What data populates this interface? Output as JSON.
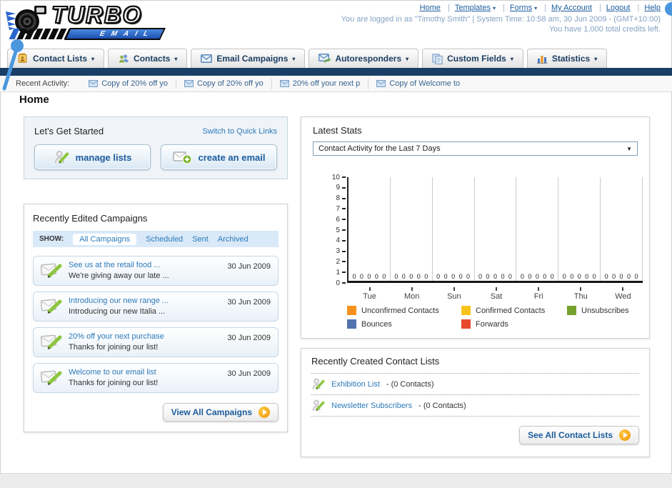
{
  "icons": {
    "chevron_down": "▾",
    "dropdown_caret": "▼"
  },
  "header": {
    "logo": {
      "title": "TURBO",
      "subtitle": "EMAIL"
    },
    "nav": [
      {
        "label": "Home",
        "dropdown": false
      },
      {
        "label": "Templates",
        "dropdown": true
      },
      {
        "label": "Forms",
        "dropdown": true
      },
      {
        "label": "My Account",
        "dropdown": false
      },
      {
        "label": "Logout",
        "dropdown": false
      },
      {
        "label": "Help",
        "dropdown": false
      }
    ],
    "login_line": "You are logged in as \"Timothy Smith\" | System Time: 10:58 am, 30 Jun 2009 - (GMT+10:00)",
    "credits_line": "You have 1,000 total credits left."
  },
  "tabs": [
    {
      "label": "Contact Lists"
    },
    {
      "label": "Contacts"
    },
    {
      "label": "Email Campaigns"
    },
    {
      "label": "Autoresponders"
    },
    {
      "label": "Custom Fields"
    },
    {
      "label": "Statistics"
    }
  ],
  "recent_activity": {
    "label": "Recent Activity:",
    "items": [
      "Copy of 20% off yo",
      "Copy of 20% off yo",
      "20% off your next p",
      "Copy of Welcome to"
    ]
  },
  "page_title": "Home",
  "get_started": {
    "title": "Let's Get Started",
    "switch_link": "Switch to Quick Links",
    "buttons": [
      {
        "label": "manage lists"
      },
      {
        "label": "create an email"
      }
    ]
  },
  "campaigns_panel": {
    "title": "Recently Edited Campaigns",
    "show_label": "SHOW:",
    "filters": [
      "All Campaigns",
      "Scheduled",
      "Sent",
      "Archived"
    ],
    "active_filter": "All Campaigns",
    "items": [
      {
        "title": "See us at the retail food ...",
        "subtitle": "We're giving away our late ...",
        "date": "30 Jun 2009"
      },
      {
        "title": "Introducing our new range ...",
        "subtitle": "Introducing our new Italia ...",
        "date": "30 Jun 2009"
      },
      {
        "title": "20% off your next purchase",
        "subtitle": "Thanks for joining our list!",
        "date": "30 Jun 2009"
      },
      {
        "title": "Welcome to our email list",
        "subtitle": "Thanks for joining our list!",
        "date": "30 Jun 2009"
      }
    ],
    "view_all_label": "View All Campaigns"
  },
  "stats_panel": {
    "title": "Latest Stats",
    "dropdown_value": "Contact Activity for the Last 7 Days"
  },
  "chart_data": {
    "type": "bar",
    "title": "Contact Activity for the Last 7 Days",
    "categories": [
      "Tue",
      "Mon",
      "Sun",
      "Sat",
      "Fri",
      "Thu",
      "Wed"
    ],
    "series": [
      {
        "name": "Unconfirmed Contacts",
        "color": "#f5911e",
        "values": [
          0,
          0,
          0,
          0,
          0,
          0,
          0
        ]
      },
      {
        "name": "Confirmed Contacts",
        "color": "#f8c31c",
        "values": [
          0,
          0,
          0,
          0,
          0,
          0,
          0
        ]
      },
      {
        "name": "Unsubscribes",
        "color": "#76a22d",
        "values": [
          0,
          0,
          0,
          0,
          0,
          0,
          0
        ]
      },
      {
        "name": "Bounces",
        "color": "#5273ae",
        "values": [
          0,
          0,
          0,
          0,
          0,
          0,
          0
        ]
      },
      {
        "name": "Forwards",
        "color": "#e8492c",
        "values": [
          0,
          0,
          0,
          0,
          0,
          0,
          0
        ]
      }
    ],
    "xlabel": "",
    "ylabel": "",
    "ylim": [
      0,
      10
    ],
    "ytick_step": 1,
    "grid": "vertical-only",
    "legend_position": "bottom",
    "data_labels": "each value shown as 0 above baseline"
  },
  "contact_lists_panel": {
    "title": "Recently Created Contact Lists",
    "items": [
      {
        "name": "Exhibition List",
        "detail": "- (0 Contacts)"
      },
      {
        "name": "Newsletter Subscribers",
        "detail": "- (0 Contacts)"
      }
    ],
    "see_all_label": "See All Contact Lists"
  },
  "colors": {
    "navy_bar": "#1a3f66",
    "link_blue": "#2d7ab9",
    "header_link": "#1b5c9e",
    "muted_login_text": "#85a2c4",
    "show_bar_bg": "#d9e9f8",
    "annotation_pin": "#4a97dd",
    "action_arrow_orange": "#f0a01e"
  }
}
